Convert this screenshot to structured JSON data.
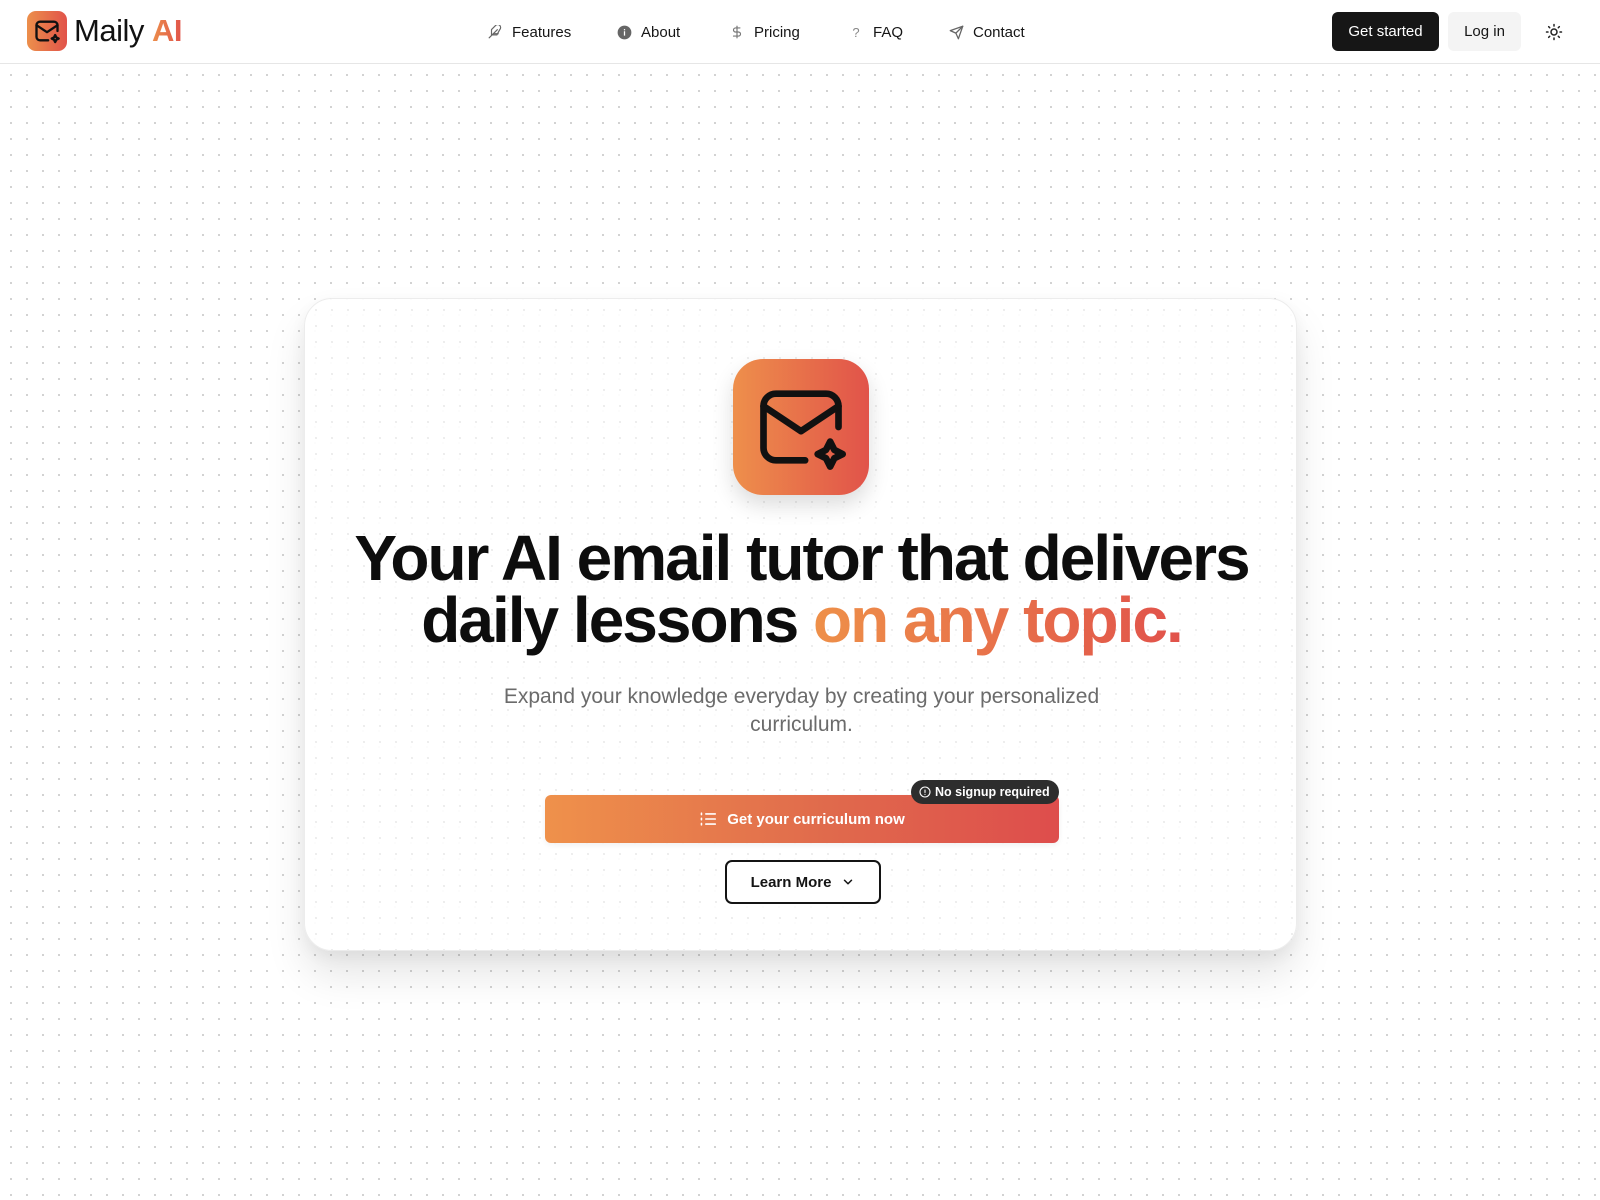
{
  "brand": {
    "name": "Maily",
    "name_accent": "AI",
    "gradient_start": "#ec8f4b",
    "gradient_end": "#e1534a",
    "logo_icon": "mail-sparkle-icon"
  },
  "nav": {
    "items": [
      {
        "label": "Features",
        "icon": "feather-icon"
      },
      {
        "label": "About",
        "icon": "info-circle-icon"
      },
      {
        "label": "Pricing",
        "icon": "dollar-icon"
      },
      {
        "label": "FAQ",
        "icon": "question-icon"
      },
      {
        "label": "Contact",
        "icon": "send-icon"
      }
    ]
  },
  "header_actions": {
    "get_started_label": "Get started",
    "login_label": "Log in",
    "theme_toggle_icon": "sun-icon"
  },
  "hero": {
    "icon": "mail-sparkle-icon",
    "headline_line1": "Your AI email tutor that delivers",
    "headline_line2_plain": "daily lessons",
    "headline_line2_accent": "on any topic.",
    "subtitle": "Expand your knowledge everyday by creating your personalized curriculum.",
    "cta_label": "Get your curriculum now",
    "cta_icon": "list-icon",
    "badge_label": "No signup required",
    "badge_icon": "info-circle-icon",
    "learn_more_label": "Learn More",
    "learn_more_icon": "chevron-down-icon"
  }
}
